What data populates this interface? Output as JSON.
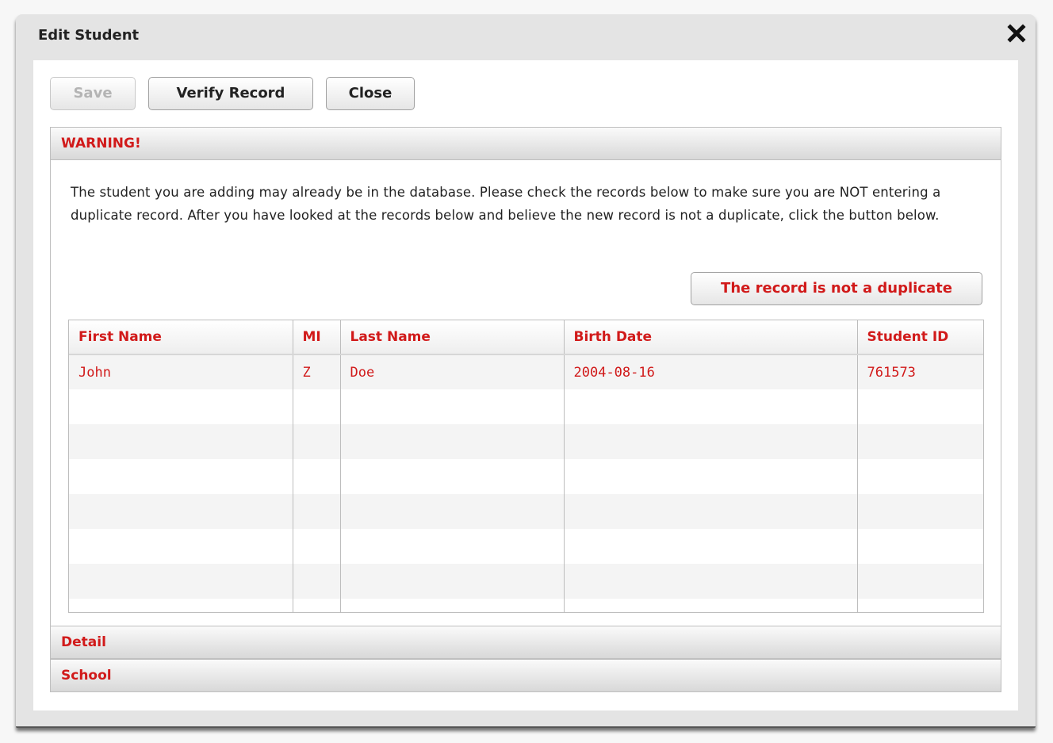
{
  "dialog": {
    "title": "Edit Student"
  },
  "toolbar": {
    "save_label": "Save",
    "verify_label": "Verify Record",
    "close_label": "Close"
  },
  "warning": {
    "header": "WARNING!",
    "message": "The student you are adding may already be in the database. Please check the records below to make sure you are NOT entering a duplicate record. After you have looked at the records below and believe the new record is not a duplicate, click the button below.",
    "not_duplicate_label": "The record is not a duplicate"
  },
  "table": {
    "columns": [
      "First Name",
      "MI",
      "Last Name",
      "Birth Date",
      "Student ID"
    ],
    "rows": [
      [
        "John",
        "Z",
        "Doe",
        "2004-08-16",
        "761573"
      ]
    ]
  },
  "sections": {
    "detail": "Detail",
    "school": "School"
  },
  "colors": {
    "accent_red": "#d11a1a",
    "header_gray": "#e4e4e4"
  },
  "icons": {
    "close": "close-x-icon"
  }
}
